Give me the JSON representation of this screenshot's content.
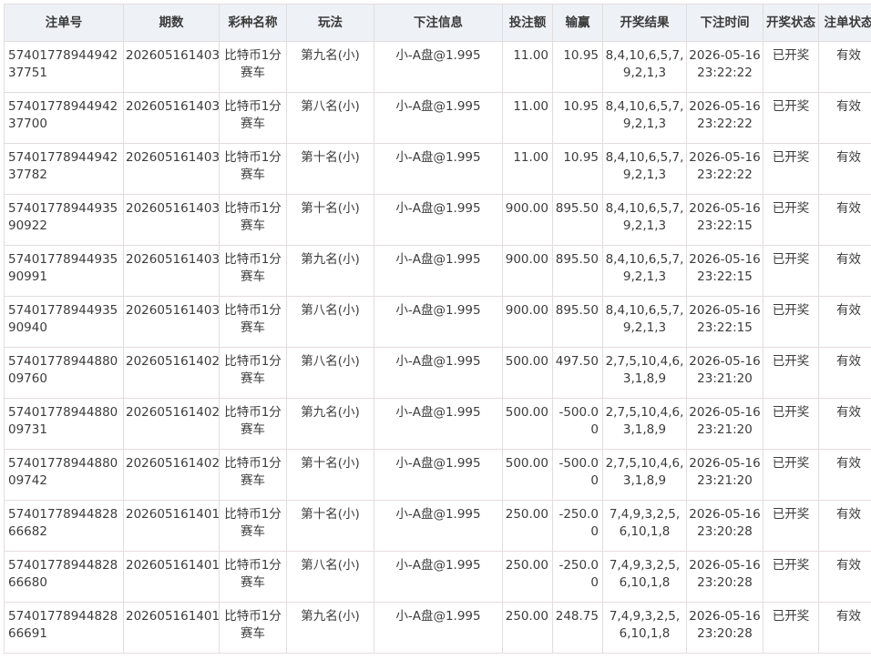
{
  "table": {
    "headers": [
      "注单号",
      "期数",
      "彩种名称",
      "玩法",
      "下注信息",
      "投注额",
      "输赢",
      "开奖结果",
      "下注时间",
      "开奖状态",
      "注单状态"
    ],
    "rows": [
      {
        "id": "5740177894494237751",
        "issue": "202605161403",
        "lottery": "比特币1分赛车",
        "play": "第九名(小)",
        "info": "小-A盘@1.995",
        "amount": "11.00",
        "win": "10.95",
        "result": "8,4,10,6,5,7,9,2,1,3",
        "time": "2026-05-16 23:22:22",
        "draw_status": "已开奖",
        "bet_status": "有效"
      },
      {
        "id": "5740177894494237700",
        "issue": "202605161403",
        "lottery": "比特币1分赛车",
        "play": "第八名(小)",
        "info": "小-A盘@1.995",
        "amount": "11.00",
        "win": "10.95",
        "result": "8,4,10,6,5,7,9,2,1,3",
        "time": "2026-05-16 23:22:22",
        "draw_status": "已开奖",
        "bet_status": "有效"
      },
      {
        "id": "5740177894494237782",
        "issue": "202605161403",
        "lottery": "比特币1分赛车",
        "play": "第十名(小)",
        "info": "小-A盘@1.995",
        "amount": "11.00",
        "win": "10.95",
        "result": "8,4,10,6,5,7,9,2,1,3",
        "time": "2026-05-16 23:22:22",
        "draw_status": "已开奖",
        "bet_status": "有效"
      },
      {
        "id": "5740177894493590922",
        "issue": "202605161403",
        "lottery": "比特币1分赛车",
        "play": "第十名(小)",
        "info": "小-A盘@1.995",
        "amount": "900.00",
        "win": "895.50",
        "result": "8,4,10,6,5,7,9,2,1,3",
        "time": "2026-05-16 23:22:15",
        "draw_status": "已开奖",
        "bet_status": "有效"
      },
      {
        "id": "5740177894493590991",
        "issue": "202605161403",
        "lottery": "比特币1分赛车",
        "play": "第九名(小)",
        "info": "小-A盘@1.995",
        "amount": "900.00",
        "win": "895.50",
        "result": "8,4,10,6,5,7,9,2,1,3",
        "time": "2026-05-16 23:22:15",
        "draw_status": "已开奖",
        "bet_status": "有效"
      },
      {
        "id": "5740177894493590940",
        "issue": "202605161403",
        "lottery": "比特币1分赛车",
        "play": "第八名(小)",
        "info": "小-A盘@1.995",
        "amount": "900.00",
        "win": "895.50",
        "result": "8,4,10,6,5,7,9,2,1,3",
        "time": "2026-05-16 23:22:15",
        "draw_status": "已开奖",
        "bet_status": "有效"
      },
      {
        "id": "5740177894488009760",
        "issue": "202605161402",
        "lottery": "比特币1分赛车",
        "play": "第八名(小)",
        "info": "小-A盘@1.995",
        "amount": "500.00",
        "win": "497.50",
        "result": "2,7,5,10,4,6,3,1,8,9",
        "time": "2026-05-16 23:21:20",
        "draw_status": "已开奖",
        "bet_status": "有效"
      },
      {
        "id": "5740177894488009731",
        "issue": "202605161402",
        "lottery": "比特币1分赛车",
        "play": "第九名(小)",
        "info": "小-A盘@1.995",
        "amount": "500.00",
        "win": "-500.00",
        "result": "2,7,5,10,4,6,3,1,8,9",
        "time": "2026-05-16 23:21:20",
        "draw_status": "已开奖",
        "bet_status": "有效"
      },
      {
        "id": "5740177894488009742",
        "issue": "202605161402",
        "lottery": "比特币1分赛车",
        "play": "第十名(小)",
        "info": "小-A盘@1.995",
        "amount": "500.00",
        "win": "-500.00",
        "result": "2,7,5,10,4,6,3,1,8,9",
        "time": "2026-05-16 23:21:20",
        "draw_status": "已开奖",
        "bet_status": "有效"
      },
      {
        "id": "5740177894482866682",
        "issue": "202605161401",
        "lottery": "比特币1分赛车",
        "play": "第十名(小)",
        "info": "小-A盘@1.995",
        "amount": "250.00",
        "win": "-250.00",
        "result": "7,4,9,3,2,5,6,10,1,8",
        "time": "2026-05-16 23:20:28",
        "draw_status": "已开奖",
        "bet_status": "有效"
      },
      {
        "id": "5740177894482866680",
        "issue": "202605161401",
        "lottery": "比特币1分赛车",
        "play": "第八名(小)",
        "info": "小-A盘@1.995",
        "amount": "250.00",
        "win": "-250.00",
        "result": "7,4,9,3,2,5,6,10,1,8",
        "time": "2026-05-16 23:20:28",
        "draw_status": "已开奖",
        "bet_status": "有效"
      },
      {
        "id": "5740177894482866691",
        "issue": "202605161401",
        "lottery": "比特币1分赛车",
        "play": "第九名(小)",
        "info": "小-A盘@1.995",
        "amount": "250.00",
        "win": "248.75",
        "result": "7,4,9,3,2,5,6,10,1,8",
        "time": "2026-05-16 23:20:28",
        "draw_status": "已开奖",
        "bet_status": "有效"
      }
    ]
  }
}
